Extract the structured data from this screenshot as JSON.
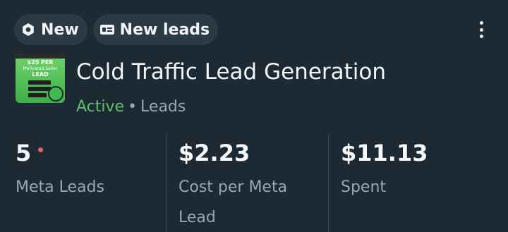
{
  "chips": [
    {
      "label": "New",
      "icon": "gear-badge-icon"
    },
    {
      "label": "New leads",
      "icon": "id-card-icon"
    }
  ],
  "more_icon": "more-vertical-icon",
  "thumbnail": {
    "line1": "$25 PER",
    "line2": "Motivated Seller",
    "line3": "LEAD"
  },
  "campaign": {
    "title": "Cold Traffic Lead Generation",
    "status": "Active",
    "separator": "•",
    "type": "Leads",
    "status_color": "#5fbf6a"
  },
  "metrics": [
    {
      "value": "5",
      "label": "Meta Leads",
      "has_dot": true
    },
    {
      "value": "$2.23",
      "label": "Cost per Meta Lead"
    },
    {
      "value": "$11.13",
      "label": "Spent"
    }
  ]
}
